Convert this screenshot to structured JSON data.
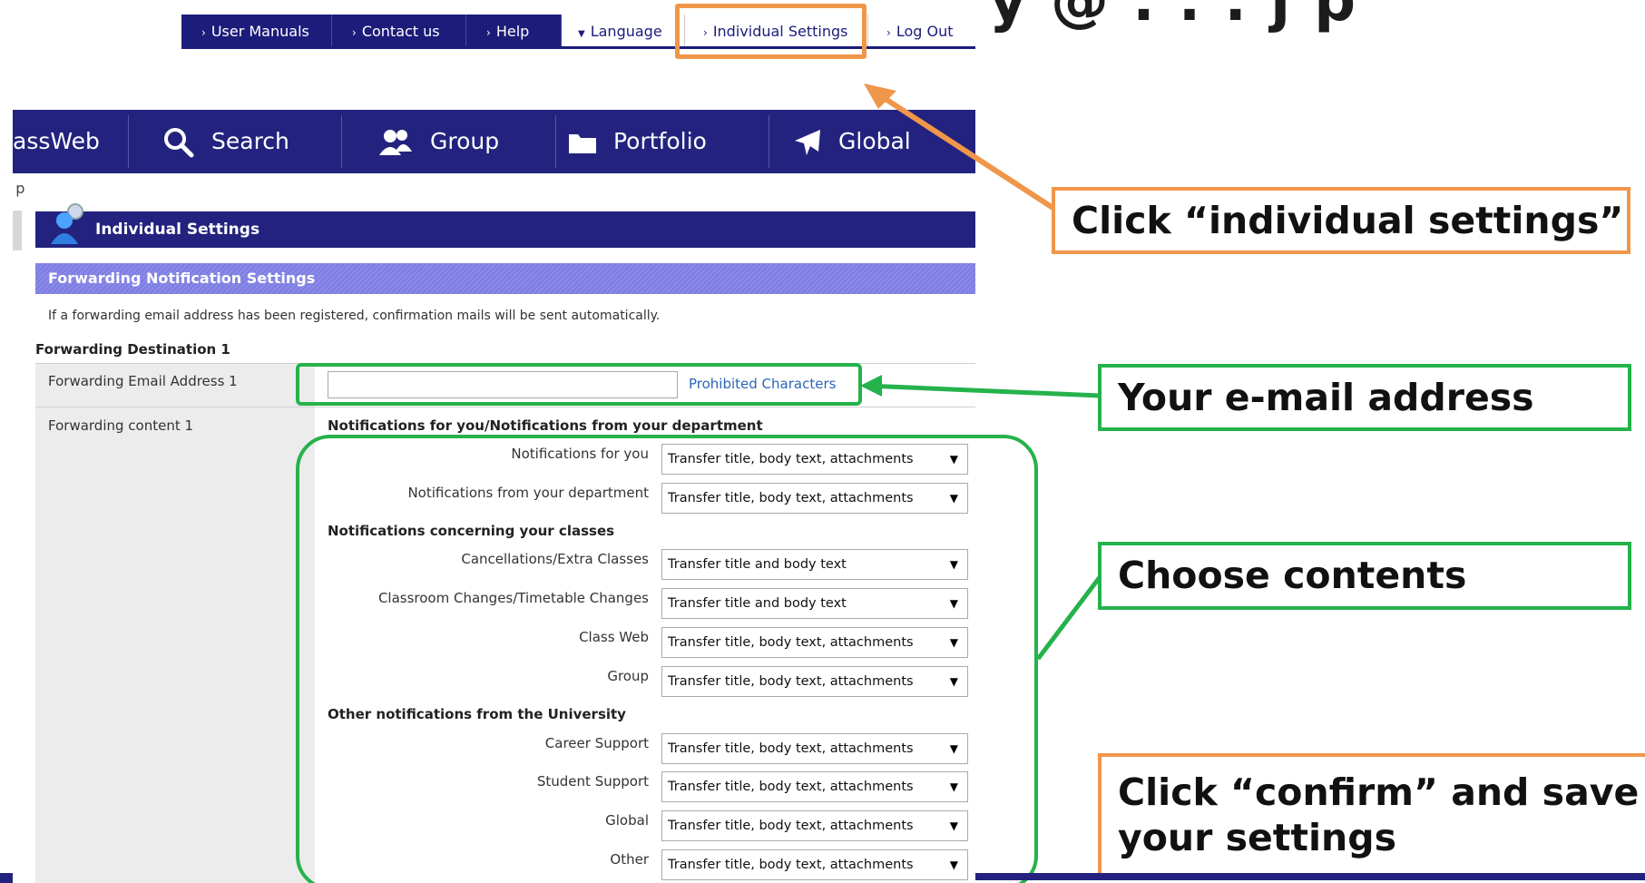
{
  "top_menu": {
    "user_manuals": "User Manuals",
    "contact_us": "Contact us",
    "help": "Help",
    "language": "Language",
    "individual_settings": "Individual Settings",
    "log_out": "Log Out"
  },
  "main_nav": {
    "classweb": "assWeb",
    "search": "Search",
    "group": "Group",
    "portfolio": "Portfolio",
    "global": "Global"
  },
  "breadcrumb": " p",
  "page": {
    "section_title": "Individual Settings",
    "subsection_title": "Forwarding Notification Settings",
    "notice": "If a forwarding email address has been registered, confirmation mails will be sent automatically.",
    "destination_heading": "Forwarding Destination 1",
    "email_label": "Forwarding Email Address 1",
    "email_value": "",
    "prohibited_link": "Prohibited Characters",
    "content_label": "Forwarding content 1"
  },
  "groups": [
    {
      "title": "Notifications for you/Notifications from your department",
      "rows": [
        {
          "label": "Notifications for you",
          "value": "Transfer title, body text, attachments"
        },
        {
          "label": "Notifications from your department",
          "value": "Transfer title, body text, attachments"
        }
      ]
    },
    {
      "title": "Notifications concerning your classes",
      "rows": [
        {
          "label": "Cancellations/Extra Classes",
          "value": "Transfer title and body text"
        },
        {
          "label": "Classroom Changes/Timetable Changes",
          "value": "Transfer title and body text"
        },
        {
          "label": "Class Web",
          "value": "Transfer title, body text, attachments"
        },
        {
          "label": "Group",
          "value": "Transfer title, body text, attachments"
        }
      ]
    },
    {
      "title": "Other notifications from the University",
      "rows": [
        {
          "label": "Career Support",
          "value": "Transfer title, body text, attachments"
        },
        {
          "label": "Student Support",
          "value": "Transfer title, body text, attachments"
        },
        {
          "label": "Global",
          "value": "Transfer title, body text, attachments"
        },
        {
          "label": "Other",
          "value": "Transfer title, body text, attachments"
        }
      ]
    }
  ],
  "annotations": {
    "click_individual": "Click “individual settings”",
    "email": "Your e-mail address",
    "choose": "Choose contents",
    "confirm_line1": "Click “confirm” and save",
    "confirm_line2": "your settings"
  },
  "colors": {
    "navy": "#23237f",
    "orange_annotation": "#f0964a",
    "green_annotation": "#25b24b",
    "link": "#2a66b8"
  }
}
